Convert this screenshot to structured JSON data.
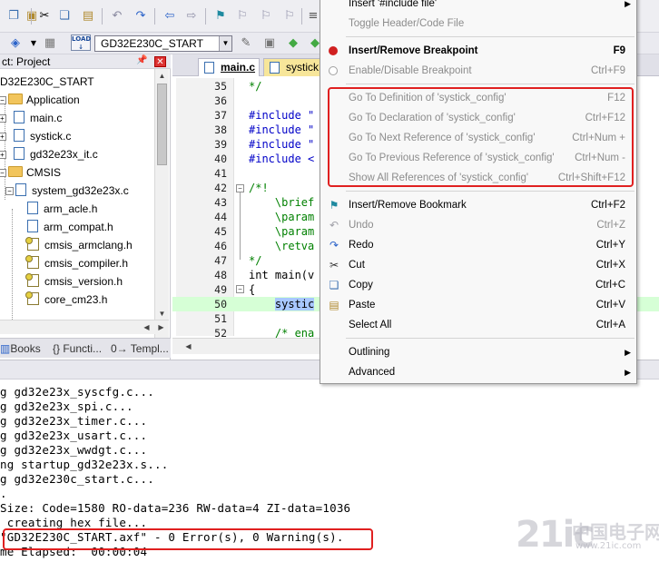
{
  "toolbar": {
    "target_name": "GD32E230C_START",
    "load_label": "LOAD"
  },
  "project_panel": {
    "header": "ct: Project",
    "items": [
      {
        "label": "D32E230C_START",
        "kind": "target"
      },
      {
        "label": "Application",
        "kind": "folder"
      },
      {
        "label": "main.c",
        "kind": "file"
      },
      {
        "label": "systick.c",
        "kind": "file"
      },
      {
        "label": "gd32e23x_it.c",
        "kind": "file"
      },
      {
        "label": "CMSIS",
        "kind": "folder"
      },
      {
        "label": "system_gd32e23x.c",
        "kind": "file"
      },
      {
        "label": "arm_acle.h",
        "kind": "header"
      },
      {
        "label": "arm_compat.h",
        "kind": "header"
      },
      {
        "label": "cmsis_armclang.h",
        "kind": "header"
      },
      {
        "label": "cmsis_compiler.h",
        "kind": "header"
      },
      {
        "label": "cmsis_version.h",
        "kind": "header"
      },
      {
        "label": "core_cm23.h",
        "kind": "header"
      }
    ],
    "tabs": [
      "Books",
      "{} Functi...",
      "0→ Templ..."
    ]
  },
  "editor": {
    "tabs": [
      {
        "label": "main.c",
        "active": true
      },
      {
        "label": "systick",
        "active": false
      }
    ],
    "lines": [
      {
        "num": "35",
        "text": "*/",
        "cls": "c-comment"
      },
      {
        "num": "36",
        "text": "",
        "cls": ""
      },
      {
        "num": "37",
        "text": "#include \"",
        "cls": "c-pre"
      },
      {
        "num": "38",
        "text": "#include \"",
        "cls": "c-pre"
      },
      {
        "num": "39",
        "text": "#include \"",
        "cls": "c-pre"
      },
      {
        "num": "40",
        "text": "#include <",
        "cls": "c-pre"
      },
      {
        "num": "41",
        "text": "",
        "cls": ""
      },
      {
        "num": "42",
        "text": "/*!",
        "cls": "c-comment"
      },
      {
        "num": "43",
        "text": "    \\brief",
        "cls": "c-comment"
      },
      {
        "num": "44",
        "text": "    \\param",
        "cls": "c-comment"
      },
      {
        "num": "45",
        "text": "    \\param",
        "cls": "c-comment"
      },
      {
        "num": "46",
        "text": "    \\retva",
        "cls": "c-comment"
      },
      {
        "num": "47",
        "text": "*/",
        "cls": "c-comment"
      },
      {
        "num": "48",
        "text": "int main(v",
        "cls": ""
      },
      {
        "num": "49",
        "text": "{",
        "cls": ""
      },
      {
        "num": "50",
        "text": "    systic",
        "cls": ""
      },
      {
        "num": "51",
        "text": "",
        "cls": ""
      },
      {
        "num": "52",
        "text": "    /* ena",
        "cls": "c-comment"
      }
    ]
  },
  "output": {
    "lines": [
      "g gd32e23x_syscfg.c...",
      "g gd32e23x_spi.c...",
      "g gd32e23x_timer.c...",
      "g gd32e23x_usart.c...",
      "g gd32e23x_wwdgt.c...",
      "ng startup_gd32e23x.s...",
      "g gd32e230c_start.c...",
      ".",
      "Size: Code=1580 RO-data=236 RW-data=4 ZI-data=1036",
      " creating hex file...",
      "\"GD32E230C_START.axf\" - 0 Error(s), 0 Warning(s).",
      "me Elapsed:  00:00:04"
    ],
    "result_prefix": ":"
  },
  "context_menu": {
    "items": [
      {
        "label": "Insert '#include file'",
        "shortcut": "",
        "disabled": false,
        "submenu": true,
        "icon": ""
      },
      {
        "label": "Toggle Header/Code File",
        "shortcut": "",
        "disabled": true,
        "submenu": false,
        "icon": ""
      },
      {
        "sep": true
      },
      {
        "label": "Insert/Remove Breakpoint",
        "shortcut": "F9",
        "disabled": false,
        "bold": true,
        "icon": "breakpoint-icon"
      },
      {
        "label": "Enable/Disable Breakpoint",
        "shortcut": "Ctrl+F9",
        "disabled": true,
        "icon": "breakpoint-disabled-icon"
      },
      {
        "sep": true
      },
      {
        "label": "Go To Definition of 'systick_config'",
        "shortcut": "F12",
        "disabled": true
      },
      {
        "label": "Go To Declaration of 'systick_config'",
        "shortcut": "Ctrl+F12",
        "disabled": true
      },
      {
        "label": "Go To Next Reference of 'systick_config'",
        "shortcut": "Ctrl+Num +",
        "disabled": true
      },
      {
        "label": "Go To Previous Reference of 'systick_config'",
        "shortcut": "Ctrl+Num -",
        "disabled": true
      },
      {
        "label": "Show All References of 'systick_config'",
        "shortcut": "Ctrl+Shift+F12",
        "disabled": true
      },
      {
        "sep": true
      },
      {
        "label": "Insert/Remove Bookmark",
        "shortcut": "Ctrl+F2",
        "disabled": false,
        "icon": "bookmark-flag-icon"
      },
      {
        "label": "Undo",
        "shortcut": "Ctrl+Z",
        "disabled": true,
        "icon": "undo-icon"
      },
      {
        "label": "Redo",
        "shortcut": "Ctrl+Y",
        "disabled": false,
        "icon": "redo-icon"
      },
      {
        "label": "Cut",
        "shortcut": "Ctrl+X",
        "disabled": false,
        "icon": "cut-icon"
      },
      {
        "label": "Copy",
        "shortcut": "Ctrl+C",
        "disabled": false,
        "icon": "copy-icon"
      },
      {
        "label": "Paste",
        "shortcut": "Ctrl+V",
        "disabled": false,
        "icon": "paste-icon"
      },
      {
        "label": "Select All",
        "shortcut": "Ctrl+A",
        "disabled": false
      },
      {
        "sep": true
      },
      {
        "label": "Outlining",
        "shortcut": "",
        "disabled": false,
        "submenu": true
      },
      {
        "label": "Advanced",
        "shortcut": "",
        "disabled": false,
        "submenu": true
      }
    ]
  },
  "watermark": {
    "big": "21ic",
    "cn": "中国电子网",
    "url": "www.21ic.com"
  },
  "colors": {
    "annotation_red": "#e02020",
    "breakpoint_red": "#d02020",
    "selection_blue": "#a8c8ff",
    "current_line_green": "#d6ffd6"
  }
}
